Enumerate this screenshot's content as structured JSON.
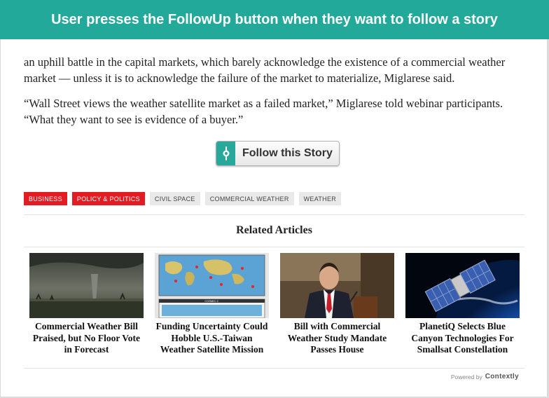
{
  "banner": {
    "text": "User presses the FollowUp button when they want to follow a story"
  },
  "article": {
    "paragraph_1": "an uphill battle in the capital markets, which barely acknowledge the existence of a commercial weather market — unless it is to acknowledge the failure of the market to materialize,  Miglarese said.",
    "paragraph_2": "“Wall Street views the weather satellite market as a failed market,” Miglarese told webinar participants. “What they want to see is evidence of a buyer.”"
  },
  "follow": {
    "label": "Follow this Story",
    "icon": "followup-icon"
  },
  "tags": [
    {
      "label": "BUSINESS",
      "style": "red"
    },
    {
      "label": "POLICY & POLITICS",
      "style": "red"
    },
    {
      "label": "CIVIL SPACE",
      "style": "gray"
    },
    {
      "label": "COMMERCIAL WEATHER",
      "style": "gray"
    },
    {
      "label": "WEATHER",
      "style": "gray"
    }
  ],
  "related": {
    "title": "Related Articles",
    "cards": [
      {
        "title": "Commercial Weather Bill Praised, but No Floor Vote in Forecast",
        "image": "tornado-photo"
      },
      {
        "title": "Funding Uncertainty Could Hobble U.S.-Taiwan Weather Satellite Mission",
        "image": "satellite-map-figure",
        "image_caption": "COSMIC 2"
      },
      {
        "title": "Bill with Commercial Weather Study Mandate Passes House",
        "image": "congressman-photo"
      },
      {
        "title": "PlanetiQ Selects Blue Canyon Technologies For Smallsat Constellation",
        "image": "smallsat-render"
      }
    ]
  },
  "footer": {
    "powered_by": "Powered by",
    "brand": "Contextly"
  },
  "colors": {
    "banner": "#22a99a",
    "tag_red": "#e31b23",
    "tag_gray": "#e9e9e9",
    "follow_icon": "#27a89a"
  }
}
